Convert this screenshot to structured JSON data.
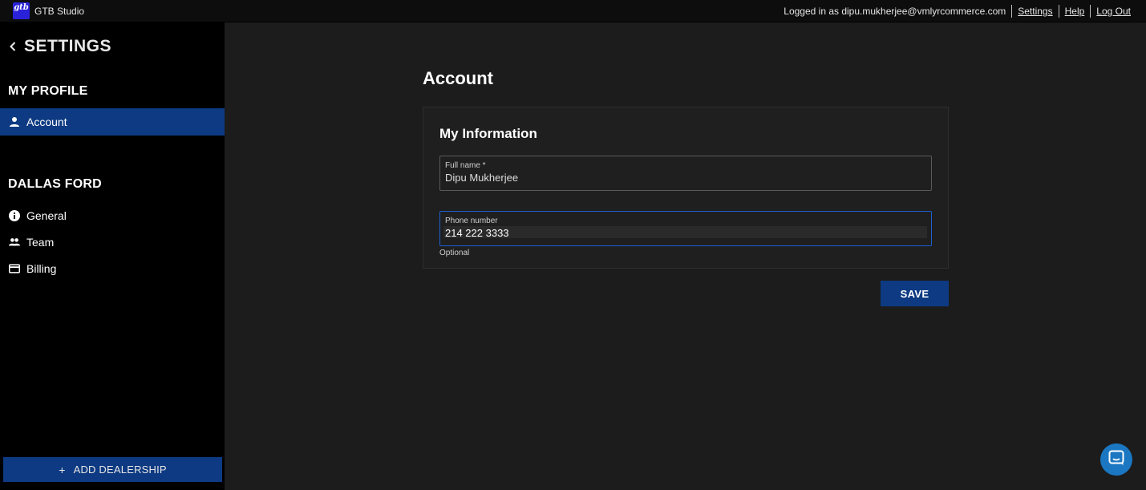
{
  "app": {
    "logo_text": "gtb",
    "title": "GTB Studio"
  },
  "topbar": {
    "logged_in_text": "Logged in as dipu.mukherjee@vmlyrcommerce.com",
    "settings_link": "Settings",
    "help_link": "Help",
    "logout_link": "Log Out"
  },
  "sidebar": {
    "header": "SETTINGS",
    "profile_section": "MY PROFILE",
    "profile_items": [
      {
        "label": "Account",
        "icon": "person-icon",
        "active": true
      }
    ],
    "dealer_section": "DALLAS FORD",
    "dealer_items": [
      {
        "label": "General",
        "icon": "info-icon"
      },
      {
        "label": "Team",
        "icon": "people-icon"
      },
      {
        "label": "Billing",
        "icon": "credit-card-icon"
      }
    ],
    "add_dealership": "ADD DEALERSHIP"
  },
  "main": {
    "page_title": "Account",
    "card_title": "My Information",
    "full_name": {
      "label": "Full name *",
      "value": "Dipu Mukherjee"
    },
    "phone": {
      "label": "Phone number",
      "value": "214 222 3333",
      "helper": "Optional"
    },
    "save_label": "SAVE"
  },
  "colors": {
    "accent": "#0d3a82",
    "focus_border": "#1f5fd1",
    "chat_button": "#1b77c2"
  }
}
